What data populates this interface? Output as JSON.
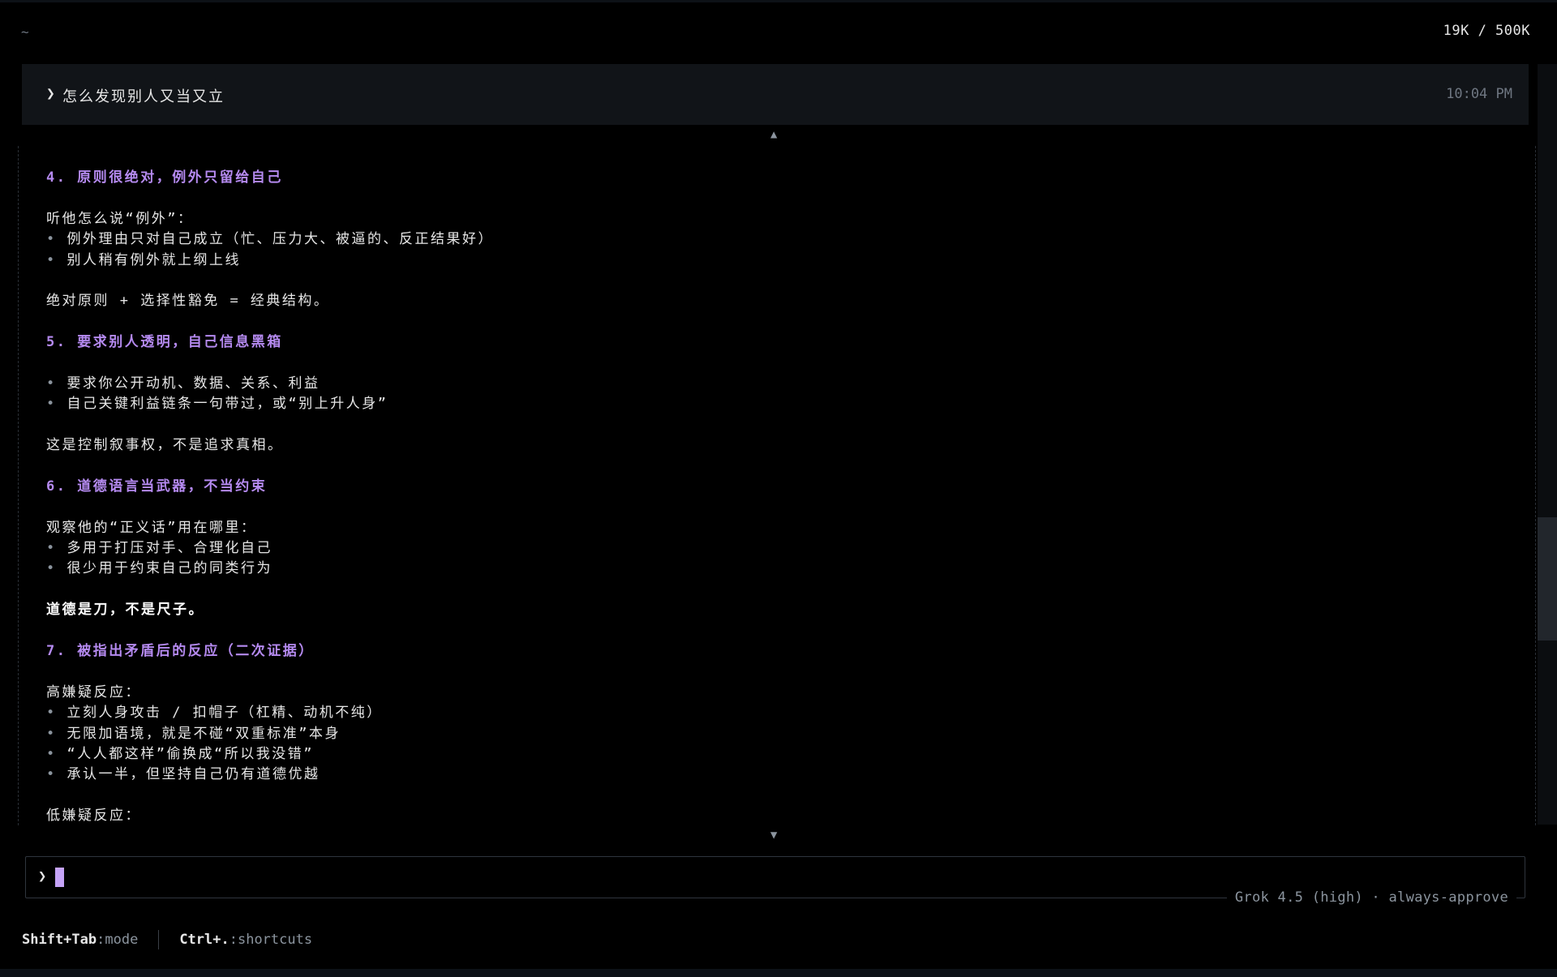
{
  "header": {
    "cwd": "~",
    "token_usage": "19K / 500K"
  },
  "user_message": {
    "prompt_symbol": "❯",
    "text": "怎么发现别人又当又立",
    "time": "10:04 PM"
  },
  "scroll": {
    "up_arrow": "▲",
    "down_arrow": "▼"
  },
  "response": {
    "lines": [
      {
        "type": "heading",
        "text": "4. 原则很绝对，例外只留给自己"
      },
      {
        "type": "blank",
        "text": ""
      },
      {
        "type": "text",
        "text": "听他怎么说“例外”："
      },
      {
        "type": "bullet",
        "text": "例外理由只对自己成立（忙、压力大、被逼的、反正结果好）"
      },
      {
        "type": "bullet",
        "text": "别人稍有例外就上纲上线"
      },
      {
        "type": "blank",
        "text": ""
      },
      {
        "type": "text",
        "text": "绝对原则 + 选择性豁免 = 经典结构。"
      },
      {
        "type": "blank",
        "text": ""
      },
      {
        "type": "heading",
        "text": "5. 要求别人透明，自己信息黑箱"
      },
      {
        "type": "blank",
        "text": ""
      },
      {
        "type": "bullet",
        "text": "要求你公开动机、数据、关系、利益"
      },
      {
        "type": "bullet",
        "text": "自己关键利益链条一句带过，或“别上升人身”"
      },
      {
        "type": "blank",
        "text": ""
      },
      {
        "type": "text",
        "text": "这是控制叙事权，不是追求真相。"
      },
      {
        "type": "blank",
        "text": ""
      },
      {
        "type": "heading",
        "text": "6. 道德语言当武器，不当约束"
      },
      {
        "type": "blank",
        "text": ""
      },
      {
        "type": "text",
        "text": "观察他的“正义话”用在哪里："
      },
      {
        "type": "bullet",
        "text": "多用于打压对手、合理化自己"
      },
      {
        "type": "bullet",
        "text": "很少用于约束自己的同类行为"
      },
      {
        "type": "blank",
        "text": ""
      },
      {
        "type": "bold",
        "text": "道德是刀，不是尺子。"
      },
      {
        "type": "blank",
        "text": ""
      },
      {
        "type": "heading",
        "text": "7. 被指出矛盾后的反应（二次证据）"
      },
      {
        "type": "blank",
        "text": ""
      },
      {
        "type": "text",
        "text": "高嫌疑反应："
      },
      {
        "type": "bullet",
        "text": "立刻人身攻击 / 扣帽子（杠精、动机不纯）"
      },
      {
        "type": "bullet",
        "text": "无限加语境，就是不碰“双重标准”本身"
      },
      {
        "type": "bullet",
        "text": "“人人都这样”偷换成“所以我没错”"
      },
      {
        "type": "bullet",
        "text": "承认一半，但坚持自己仍有道德优越"
      },
      {
        "type": "blank",
        "text": ""
      },
      {
        "type": "text",
        "text": "低嫌疑反应："
      }
    ],
    "bullet_symbol": "•"
  },
  "input": {
    "prompt_symbol": "❯",
    "value": "",
    "model_status": "Grok 4.5 (high) · always-approve"
  },
  "footer": {
    "mode_key": "Shift+Tab",
    "mode_label": ":mode",
    "shortcuts_key": "Ctrl+.",
    "shortcuts_label": ":shortcuts"
  },
  "colors": {
    "background": "#000000",
    "heading": "#b58af0",
    "cursor": "#c5a3f7",
    "muted": "#8b949e"
  }
}
